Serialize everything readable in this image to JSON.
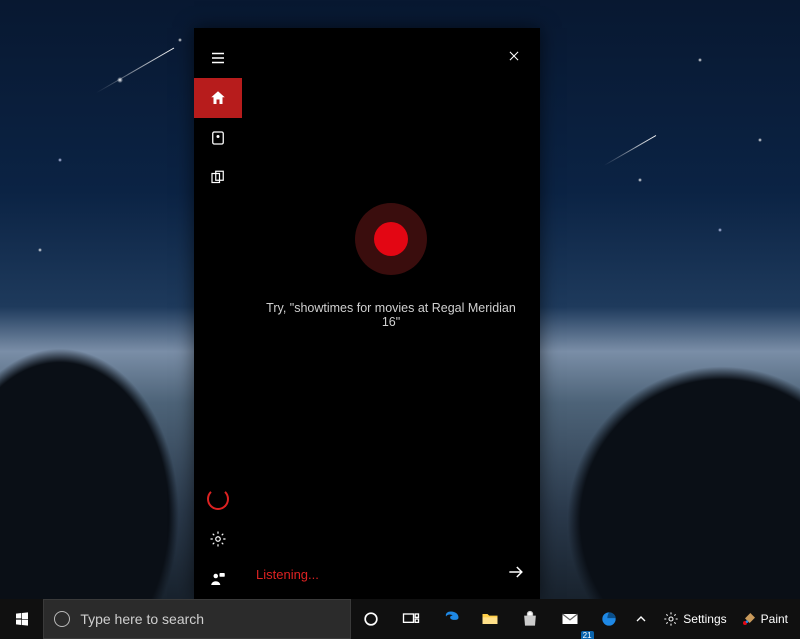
{
  "cortana": {
    "close_label": "Close",
    "nav": {
      "menu": "Menu",
      "home": "Home",
      "notebook": "Notebook",
      "devices": "Collections",
      "cortana": "Cortana",
      "settings": "Settings",
      "feedback": "Feedback"
    },
    "suggestion": "Try, \"showtimes for movies at Regal Meridian 16\"",
    "status": "Listening...",
    "submit_label": "Submit"
  },
  "taskbar": {
    "start": "Start",
    "search_placeholder": "Type here to search",
    "cortana_circle": "Talk to Cortana",
    "taskview": "Task View",
    "apps": {
      "edge": "Microsoft Edge",
      "file_explorer": "File Explorer",
      "store": "Microsoft Store",
      "mail": "Mail",
      "edge_dev": "Microsoft Edge Dev"
    },
    "mail_badge": "21",
    "tray": {
      "chevron": "Show hidden icons",
      "settings_label": "Settings",
      "paint_label": "Paint"
    }
  },
  "colors": {
    "accent_red": "#b71c1c",
    "orb_core": "#e30613",
    "status_red": "#d22"
  }
}
